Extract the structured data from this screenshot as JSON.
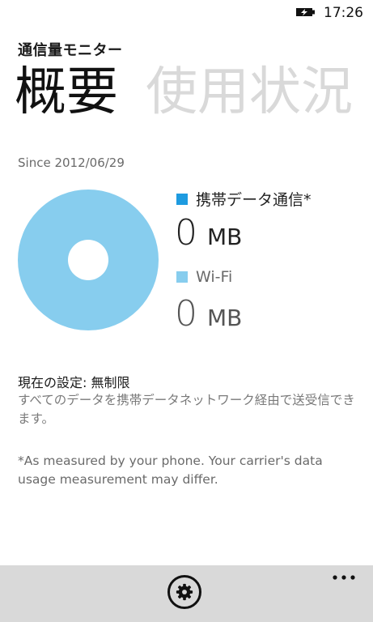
{
  "status_bar": {
    "time": "17:26",
    "battery_icon": "battery-charging-icon"
  },
  "app": {
    "title": "通信量モニター"
  },
  "pivot": {
    "items": [
      "概要",
      "使用状況"
    ],
    "active_index": 0
  },
  "summary": {
    "since": "Since 2012/06/29",
    "mobile": {
      "label": "携帯データ通信*",
      "value": "0",
      "unit": "MB",
      "color": "#1e9be0"
    },
    "wifi": {
      "label": "Wi-Fi",
      "value": "0",
      "unit": "MB",
      "color": "#87cdee"
    }
  },
  "settings": {
    "title": "現在の設定: 無制限",
    "description": "すべてのデータを携帯データネットワーク経由で送受信できます。"
  },
  "note": "*As measured by your phone. Your carrier's data usage measurement may differ.",
  "app_bar": {
    "settings_icon": "gear-icon",
    "more_icon": "ellipsis-icon",
    "background": "#d9d9d9"
  }
}
